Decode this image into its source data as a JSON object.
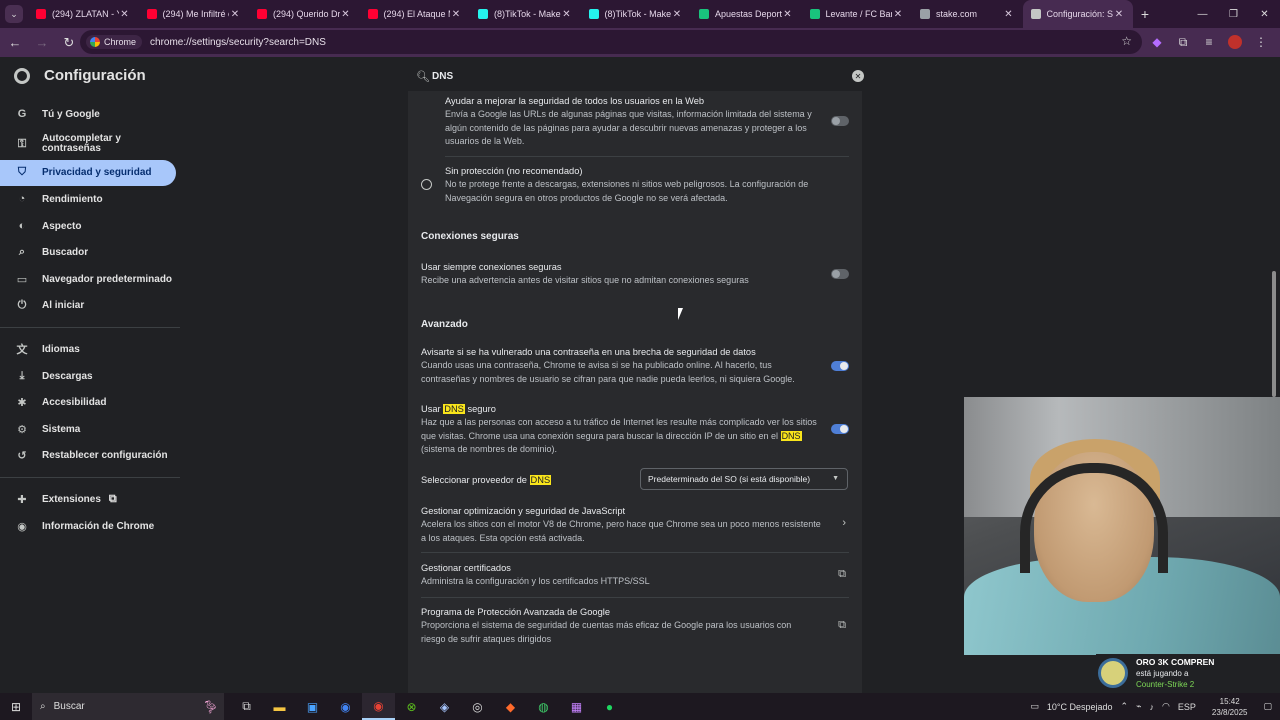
{
  "tabs": [
    {
      "title": "(294) ZLATAN - Yo",
      "icon": "youtube-icon",
      "color": "#ff0033"
    },
    {
      "title": "(294) Me Infiltré e",
      "icon": "youtube-icon",
      "color": "#ff0033"
    },
    {
      "title": "(294) Querido Dr",
      "icon": "youtube-icon",
      "color": "#ff0033"
    },
    {
      "title": "(294) El Ataque M",
      "icon": "youtube-icon",
      "color": "#ff0033"
    },
    {
      "title": "(8)TikTok - Make",
      "icon": "tiktok-icon",
      "color": "#25f4ee"
    },
    {
      "title": "(8)TikTok - Make",
      "icon": "tiktok-icon",
      "color": "#25f4ee"
    },
    {
      "title": "Apuestas Deport",
      "icon": "betting-icon",
      "color": "#19c37d"
    },
    {
      "title": "Levante / FC Barc",
      "icon": "betting-icon",
      "color": "#19c37d"
    },
    {
      "title": "stake.com",
      "icon": "globe-icon",
      "color": "#9aa0a6"
    },
    {
      "title": "Configuración: Se",
      "icon": "gear-icon",
      "color": "#c4c7c5",
      "active": true
    }
  ],
  "toolbar": {
    "chip": "Chrome",
    "url": "chrome://settings/security?search=DNS"
  },
  "header": {
    "title": "Configuración",
    "search_value": "DNS"
  },
  "sidebar": {
    "items": [
      {
        "label": "Tú y Google",
        "icon": "G"
      },
      {
        "label": "Autocompletar y contraseñas",
        "icon": "⚿"
      },
      {
        "label": "Privacidad y seguridad",
        "icon": "⛉"
      },
      {
        "label": "Rendimiento",
        "icon": "◔"
      },
      {
        "label": "Aspecto",
        "icon": "◐"
      },
      {
        "label": "Buscador",
        "icon": "⌕"
      },
      {
        "label": "Navegador predeterminado",
        "icon": "▭"
      },
      {
        "label": "Al iniciar",
        "icon": "⏻"
      },
      {
        "label": "Idiomas",
        "icon": "文"
      },
      {
        "label": "Descargas",
        "icon": "⤓"
      },
      {
        "label": "Accesibilidad",
        "icon": "✱"
      },
      {
        "label": "Sistema",
        "icon": "⚙"
      },
      {
        "label": "Restablecer configuración",
        "icon": "↺"
      },
      {
        "label": "Extensiones",
        "icon": "✚"
      },
      {
        "label": "Información de Chrome",
        "icon": "◉"
      }
    ]
  },
  "content": {
    "enhanced_help": {
      "title": "Ayudar a mejorar la seguridad de todos los usuarios en la Web",
      "desc": "Envía a Google las URLs de algunas páginas que visitas, información limitada del sistema y algún contenido de las páginas para ayudar a descubrir nuevas amenazas y proteger a los usuarios de la Web."
    },
    "no_protection": {
      "title": "Sin protección (no recomendado)",
      "desc": "No te protege frente a descargas, extensiones ni sitios web peligrosos. La configuración de Navegación segura en otros productos de Google no se verá afectada."
    },
    "secure_connections_title": "Conexiones seguras",
    "always_secure": {
      "title": "Usar siempre conexiones seguras",
      "desc": "Recibe una advertencia antes de visitar sitios que no admitan conexiones seguras"
    },
    "advanced_title": "Avanzado",
    "password_breach": {
      "title": "Avisarte si se ha vulnerado una contraseña en una brecha de seguridad de datos",
      "desc": "Cuando usas una contraseña, Chrome te avisa si se ha publicado online. Al hacerlo, tus contraseñas y nombres de usuario se cifran para que nadie pueda leerlos, ni siquiera Google."
    },
    "secure_dns": {
      "title_pre": "Usar",
      "title_hl": "DNS",
      "title_post": "seguro",
      "desc_pre": "Haz que a las personas con acceso a tu tráfico de Internet les resulte más complicado ver los sitios que visitas. Chrome usa una conexión segura para buscar la dirección IP de un sitio en el",
      "desc_hl": "DNS",
      "desc_post": "(sistema de nombres de dominio)."
    },
    "dns_provider": {
      "label_pre": "Seleccionar proveedor de",
      "label_hl": "DNS",
      "selected": "Predeterminado del SO (si está disponible)"
    },
    "javascript": {
      "title": "Gestionar optimización y seguridad de JavaScript",
      "desc": "Acelera los sitios con el motor V8 de Chrome, pero hace que Chrome sea un poco menos resistente a los ataques. Esta opción está activada."
    },
    "certificates": {
      "title": "Gestionar certificados",
      "desc": "Administra la configuración y los certificados HTTPS/SSL"
    },
    "advanced_protection": {
      "title": "Programa de Protección Avanzada de Google",
      "desc": "Proporciona el sistema de seguridad de cuentas más eficaz de Google para los usuarios con riesgo de sufrir ataques dirigidos"
    },
    "toggles": {
      "enhanced_help": false,
      "always_secure": false,
      "password_breach": true,
      "secure_dns": true
    }
  },
  "overlay": {
    "name": "ORO 3K COMPREN",
    "status": "está jugando a",
    "game": "Counter-Strike 2"
  },
  "taskbar": {
    "search_placeholder": "Buscar",
    "weather": "10°C  Despejado",
    "lang": "ESP",
    "time": "15:42",
    "date": "23/8/2025"
  },
  "colors": {
    "accent": "#a8c7fa",
    "highlight": "#f9e51b",
    "toggle_on": "#4f7fd6"
  }
}
